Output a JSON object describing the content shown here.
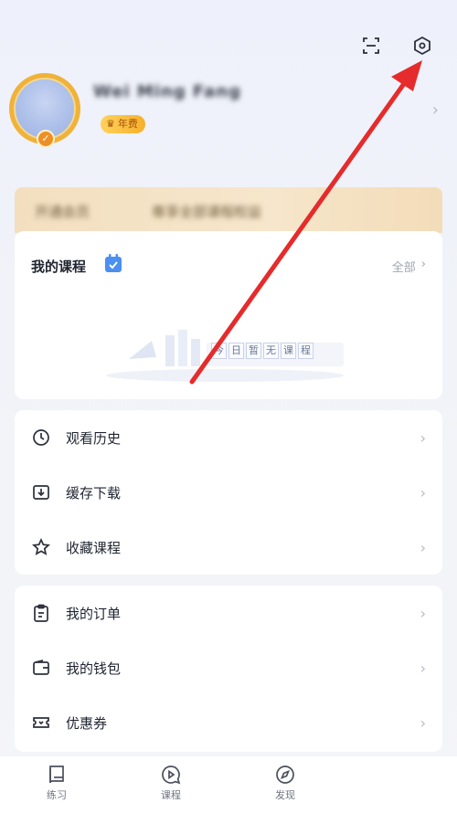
{
  "header": {
    "scan_icon": "scan-icon",
    "settings_icon": "settings-icon"
  },
  "profile": {
    "username": "Wei Ming Fang",
    "vip_label": "年费"
  },
  "vip_strip": {
    "left_text": "开通会员",
    "right_text": "尊享全部课程权益"
  },
  "courses": {
    "title": "我的课程",
    "all_label": "全部",
    "empty_chars": [
      "今",
      "日",
      "暂",
      "无",
      "课",
      "程"
    ]
  },
  "menu_group_1": [
    {
      "label": "观看历史",
      "icon": "clock-icon"
    },
    {
      "label": "缓存下载",
      "icon": "download-icon"
    },
    {
      "label": "收藏课程",
      "icon": "star-icon"
    }
  ],
  "menu_group_2": [
    {
      "label": "我的订单",
      "icon": "clipboard-icon"
    },
    {
      "label": "我的钱包",
      "icon": "wallet-icon"
    },
    {
      "label": "优惠券",
      "icon": "coupon-icon"
    }
  ],
  "tabbar": [
    {
      "label": "练习",
      "icon": "book-icon"
    },
    {
      "label": "课程",
      "icon": "play-bubble-icon"
    },
    {
      "label": "发现",
      "icon": "compass-icon"
    }
  ],
  "colors": {
    "accent_gold": "#f0b23a",
    "annotation_red": "#e52b2b",
    "blue_icon": "#4b8ff0"
  }
}
